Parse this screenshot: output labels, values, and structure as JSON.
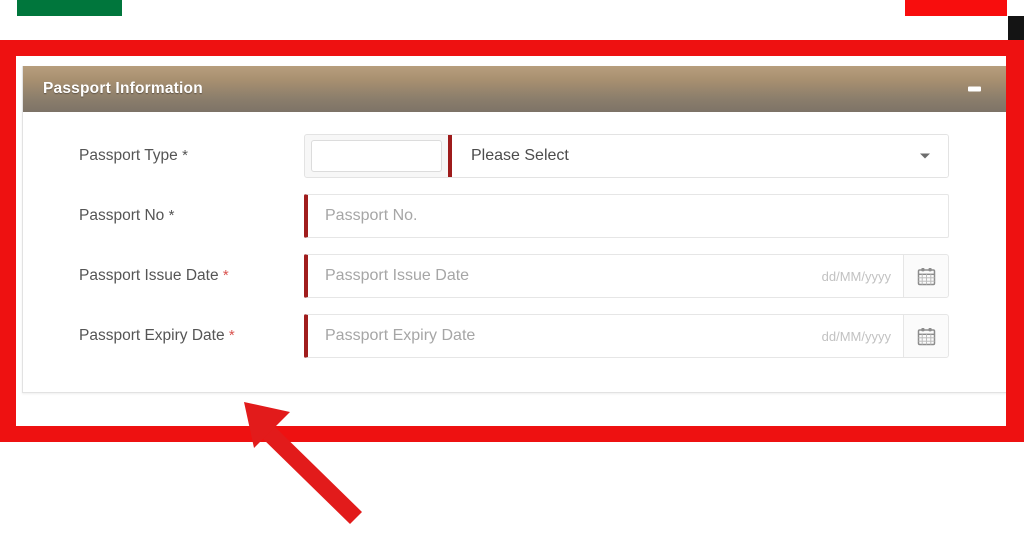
{
  "page": {
    "panel": {
      "title": "Passport Information",
      "collapse_icon": "minus-icon",
      "collapsed": false
    },
    "fields": [
      {
        "id": "passport-type",
        "label": "Passport Type",
        "required_marker": "*",
        "control": "select",
        "value": "Please Select",
        "caret_icon": "chevron-down-icon",
        "has_prefix_box": true
      },
      {
        "id": "passport-no",
        "label": "Passport No",
        "required_marker": "*",
        "control": "text",
        "placeholder": "Passport No.",
        "value": ""
      },
      {
        "id": "passport-issue-date",
        "label": "Passport Issue Date",
        "required_marker": "*",
        "control": "date",
        "placeholder": "Passport Issue Date",
        "value": "",
        "format_hint": "dd/MM/yyyy",
        "calendar_icon": "calendar-icon"
      },
      {
        "id": "passport-expiry-date",
        "label": "Passport Expiry Date",
        "required_marker": "*",
        "control": "date",
        "placeholder": "Passport Expiry Date",
        "value": "",
        "format_hint": "dd/MM/yyyy",
        "calendar_icon": "calendar-icon"
      }
    ]
  },
  "annotations": {
    "highlight_color": "#ee1111",
    "arrow_color": "#e21b1b",
    "arrow_direction": "up-left",
    "top_bar_green": "#00763c",
    "top_bar_red": "#f80d0d",
    "right_strip_black": "#141414"
  },
  "theme": {
    "header_gradient_start": "#b79e7d",
    "header_gradient_end": "#7d7367",
    "required_star_color": "#d9534f",
    "field_accent_red": "#a01d1d",
    "label_color": "#555555",
    "placeholder_color": "#a6a6a6"
  }
}
